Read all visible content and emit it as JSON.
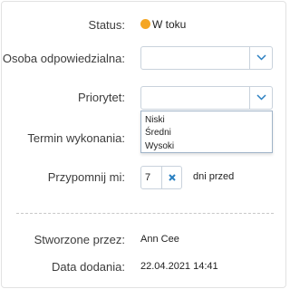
{
  "status": {
    "label": "Status:",
    "value": "W toku",
    "dot_color": "#f5a623"
  },
  "assignee": {
    "label": "Osoba odpowiedzialna:",
    "value": ""
  },
  "priority": {
    "label": "Priorytet:",
    "value": "",
    "options": [
      "Niski",
      "Średni",
      "Wysoki"
    ],
    "dropdown_open": true
  },
  "due_date": {
    "label": "Termin wykonania:"
  },
  "reminder": {
    "label": "Przypomnij mi:",
    "value": "7",
    "suffix": "dni przed"
  },
  "created_by": {
    "label": "Stworzone przez:",
    "value": "Ann Cee"
  },
  "date_added": {
    "label": "Data dodania:",
    "value": "22.04.2021 14:41"
  },
  "icons": {
    "chevron": "chevron-down-icon",
    "clear": "close-icon"
  },
  "colors": {
    "accent": "#2a7fc1",
    "border": "#c9d2dc"
  }
}
